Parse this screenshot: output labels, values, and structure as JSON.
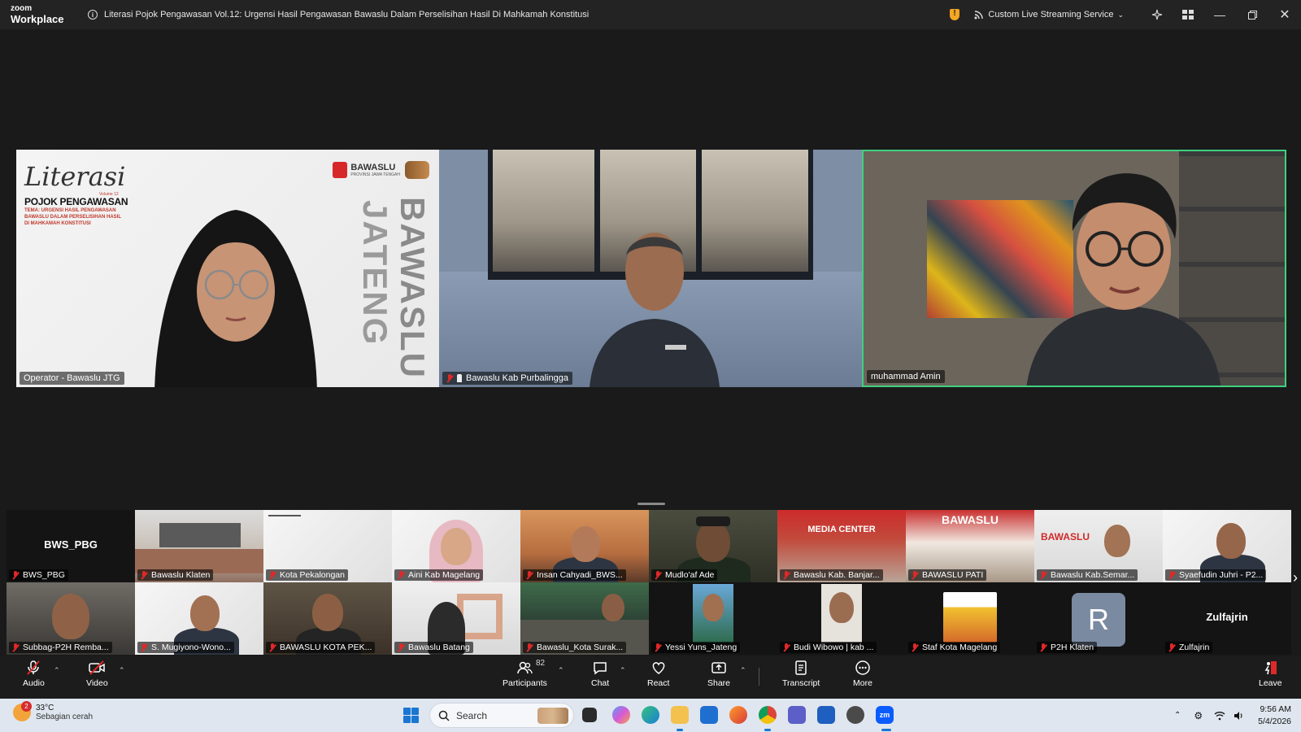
{
  "app": {
    "brand_top": "zoom",
    "brand_bottom": "Workplace",
    "meeting_title": "Literasi Pojok Pengawasan Vol.12: Urgensi Hasil Pengawasan Bawaslu Dalam Perselisihan Hasil Di Mahkamah Konstitusi",
    "streaming_label": "Custom Live Streaming Service",
    "colors": {
      "active_speaker": "#3ed17e",
      "mic_muted": "#e02828",
      "security": "#f5a623"
    }
  },
  "main_tiles": [
    {
      "name": "Operator - Bawaslu JTG",
      "slide": {
        "title": "Literasi",
        "subtitle": "POJOK PENGAWASAN",
        "volume": "Volume 12",
        "theme": "TEMA: URGENSI HASIL PENGAWASAN BAWASLU DALAM PERSELISIHAN HASIL DI MAHKAMAH KONSTITUSI",
        "logo_text": "BAWASLU",
        "logo_sub": "PROVINSI JAWA TENGAH",
        "vertical_1": "BAWASLU",
        "vertical_2": "JATENG"
      }
    },
    {
      "name": "Bawaslu Kab Purbalingga",
      "muted": true,
      "pinned": true
    },
    {
      "name": "muhammad Amin",
      "active_speaker": true
    }
  ],
  "thumbnails": {
    "row1": [
      {
        "name": "BWS_PBG",
        "display": "BWS_PBG"
      },
      {
        "name": "Bawaslu Klaten"
      },
      {
        "name": "Kota Pekalongan"
      },
      {
        "name": "Aini Kab Magelang"
      },
      {
        "name": "Insan Cahyadi_BWS..."
      },
      {
        "name": "Mudlo'af Ade"
      },
      {
        "name": "Bawaslu Kab. Banjar...",
        "overlay": "MEDIA CENTER"
      },
      {
        "name": "BAWASLU PATI",
        "overlay": "BAWASLU"
      },
      {
        "name": "Bawaslu Kab.Semar...",
        "overlay": "BAWASLU"
      },
      {
        "name": "Syaefudin Juhri - P2..."
      }
    ],
    "row2": [
      {
        "name": "Subbag-P2H Remba..."
      },
      {
        "name": "S. Mugiyono-Wono..."
      },
      {
        "name": "BAWASLU KOTA PEK..."
      },
      {
        "name": "Bawaslu Batang"
      },
      {
        "name": "Bawaslu_Kota Surak..."
      },
      {
        "name": "Yessi Yuns_Jateng"
      },
      {
        "name": "Budi Wibowo | kab ..."
      },
      {
        "name": "Staf Kota Magelang"
      },
      {
        "name": "P2H Klaten",
        "avatar_letter": "R"
      },
      {
        "name": "Zulfajrin",
        "display": "Zulfajrin"
      }
    ]
  },
  "toolbar": {
    "audio": "Audio",
    "video": "Video",
    "participants": "Participants",
    "participants_count": "82",
    "chat": "Chat",
    "react": "React",
    "share": "Share",
    "transcript": "Transcript",
    "more": "More",
    "leave": "Leave"
  },
  "taskbar": {
    "weather_temp": "33°C",
    "weather_desc": "Sebagian cerah",
    "weather_alerts": "2",
    "search_placeholder": "Search",
    "time": "9:56 AM",
    "date": "5/4/2026"
  }
}
